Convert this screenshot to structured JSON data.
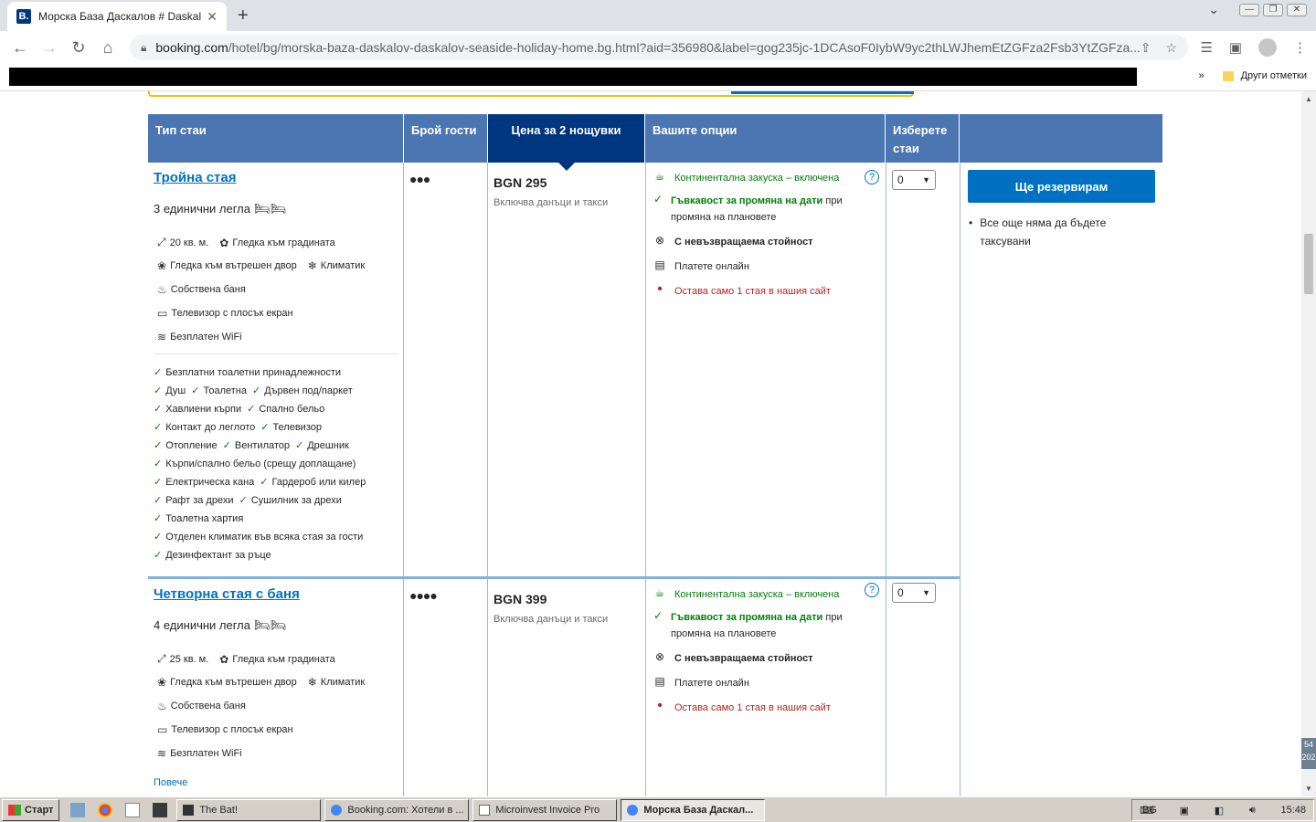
{
  "browser": {
    "tab_title": "Морска База Даскалов # Daskalov",
    "favicon_letter": "B.",
    "url_domain": "booking.com",
    "url_path": "/hotel/bg/morska-baza-daskalov-daskalov-seaside-holiday-home.bg.html?aid=356980&label=gog235jc-1DCAsoF0IybW9yc2thLWJhemEtZGFza2Fsb3YtZGFza...",
    "bookmarks_other": "Други отметки",
    "bookmarks_chevron": "»"
  },
  "table": {
    "headers": [
      "Тип стаи",
      "Брой гости",
      "Цена за 2 нощувки",
      "Вашите опции",
      "Изберете стаи",
      ""
    ],
    "reserve_button": "Ще резервирам",
    "reserve_note": "Все още няма да бъдете таксувани"
  },
  "rooms": [
    {
      "name": "Тройна стая",
      "beds": "3 единични легла",
      "guests_icons": "●●●",
      "size": "20 кв. м.",
      "facilities": [
        "Гледка към градината",
        "Гледка към вътрешен двор",
        "Климатик",
        "Собствена баня",
        "Телевизор с плосък екран",
        "Безплатен WiFi"
      ],
      "amenities_rows": [
        [
          "Безплатни тоалетни принадлежности"
        ],
        [
          "Душ",
          "Тоалетна",
          "Дървен под/паркет"
        ],
        [
          "Хавлиени кърпи",
          "Спално бельо"
        ],
        [
          "Контакт до леглото",
          "Телевизор"
        ],
        [
          "Отопление",
          "Вентилатор",
          "Дрешник"
        ],
        [
          "Кърпи/спално бельо (срещу доплащане)"
        ],
        [
          "Електрическа кана",
          "Гардероб или килер"
        ],
        [
          "Рафт за дрехи",
          "Сушилник за дрехи"
        ],
        [
          "Тоалетна хартия"
        ],
        [
          "Отделен климатик във всяка стая за гости"
        ],
        [
          "Дезинфектант за ръце"
        ]
      ],
      "price": "BGN 295",
      "taxes": "Включва данъци и такси",
      "options": {
        "breakfast": "Континентална закуска – включена",
        "flex_bold": "Гъвкавост за промяна на дати",
        "flex_rest": " при промяна на плановете",
        "nonrefund": "С невъзвращаема стойност",
        "pay": "Платете онлайн",
        "left": "Остава само 1 стая в нашия сайт"
      },
      "select_value": "0"
    },
    {
      "name": "Четворна стая с баня",
      "beds": "4 единични легла",
      "guests_icons": "●●●●",
      "size": "25 кв. м.",
      "facilities": [
        "Гледка към градината",
        "Гледка към вътрешен двор",
        "Климатик",
        "Собствена баня",
        "Телевизор с плосък екран",
        "Безплатен WiFi"
      ],
      "more": "Повече",
      "price": "BGN 399",
      "taxes": "Включва данъци и такси",
      "options": {
        "breakfast": "Континентална закуска – включена",
        "flex_bold": "Гъвкавост за промяна на дати",
        "flex_rest": " при промяна на плановете",
        "nonrefund": "С невъзвращаема стойност",
        "pay": "Платете онлайн",
        "left": "Остава само 1 стая в нашия сайт"
      },
      "select_value": "0"
    }
  ],
  "taskbar": {
    "start": "Старт",
    "items": [
      "The Bat!",
      "Booking.com: Хотели в ...",
      "Microinvest Invoice Pro",
      "Морска База Даскал..."
    ],
    "lang": "BG",
    "clock": "15:48",
    "corner_text": "54 202"
  }
}
